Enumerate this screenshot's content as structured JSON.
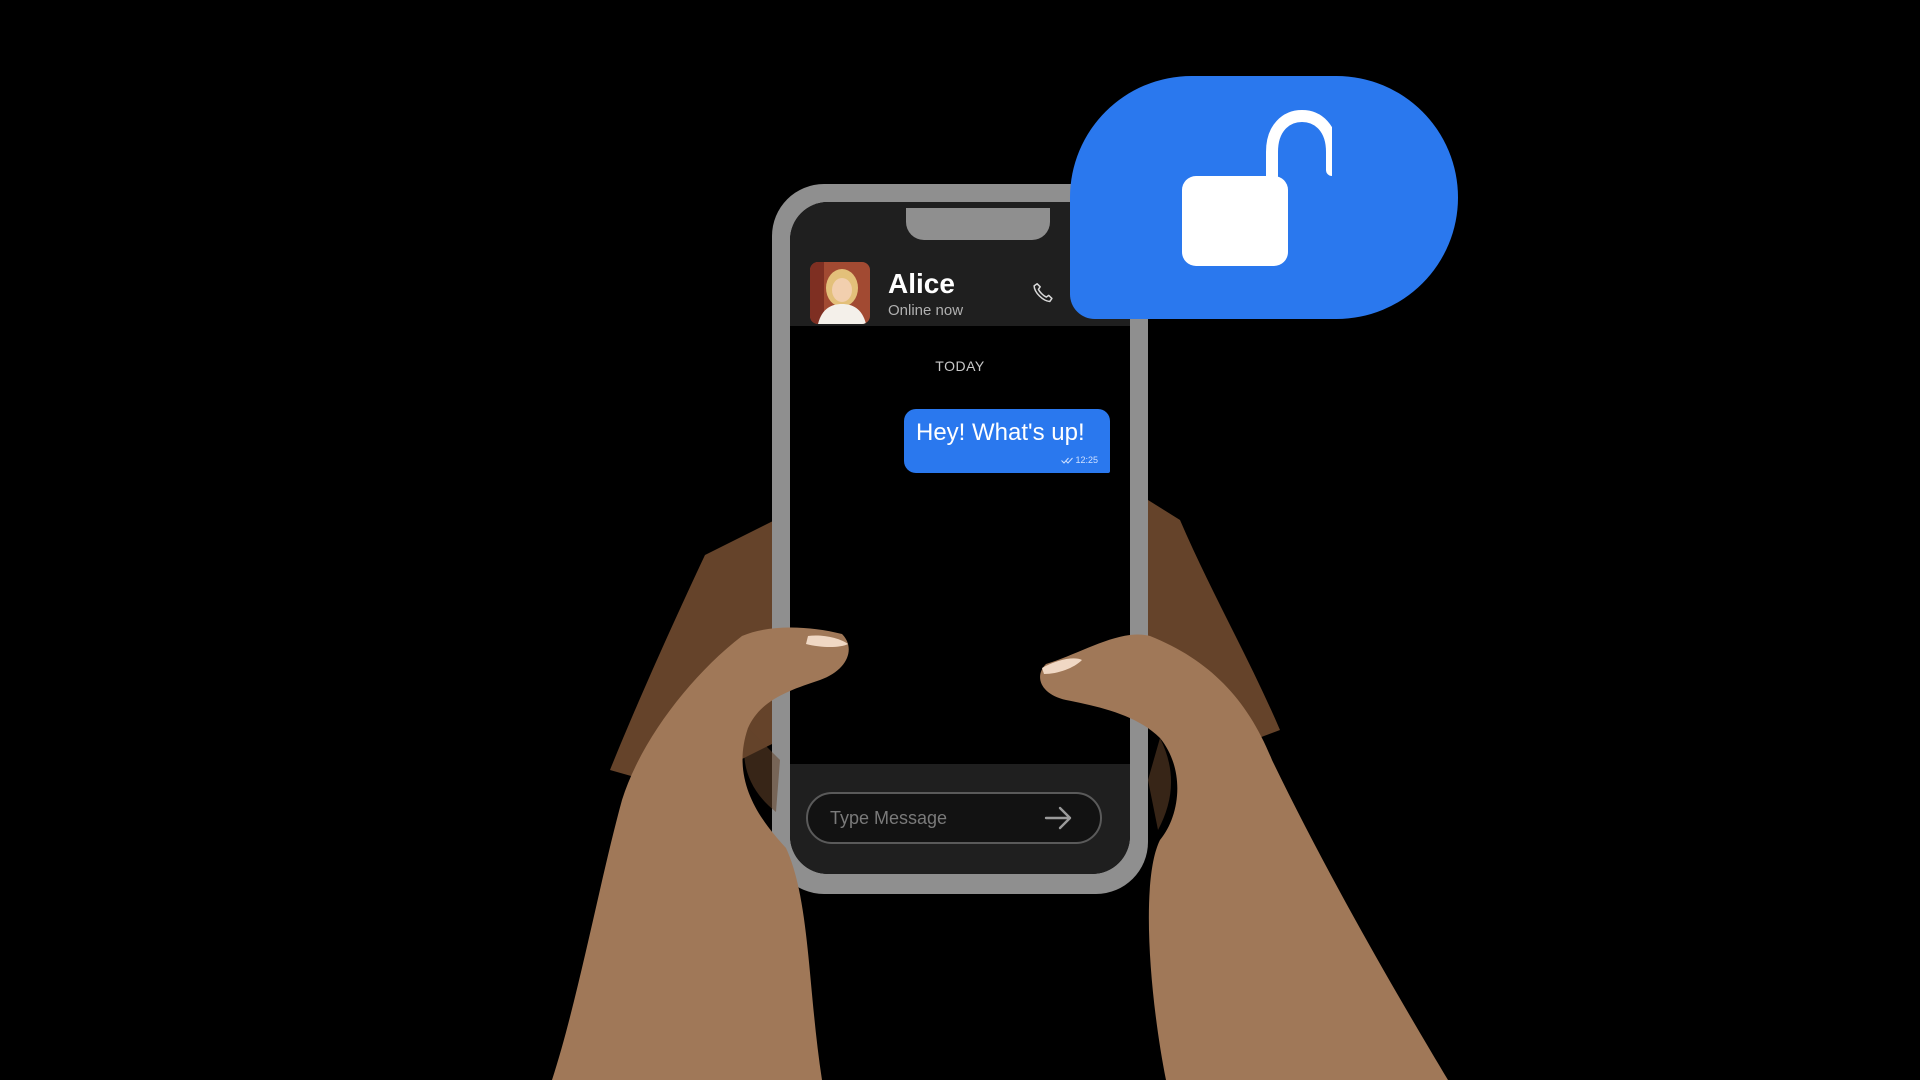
{
  "colors": {
    "background": "#000000",
    "accent_blue": "#2a78ee",
    "phone_frame": "#8f8f8f",
    "skin": "#a07858",
    "skin_shadow": "#65432a",
    "nail": "#f0d8c4"
  },
  "chat": {
    "contact": {
      "name": "Alice",
      "status": "Online now",
      "call_icon": "phone-icon"
    },
    "date_separator": "TODAY",
    "messages": [
      {
        "text": "Hey! What's up!",
        "time": "12:25",
        "outgoing": true,
        "status_icon": "double-check-icon"
      }
    ],
    "composer": {
      "placeholder": "Type Message",
      "value": "",
      "send_icon": "arrow-right-icon"
    }
  },
  "badge": {
    "icon": "unlocked-padlock-icon"
  }
}
